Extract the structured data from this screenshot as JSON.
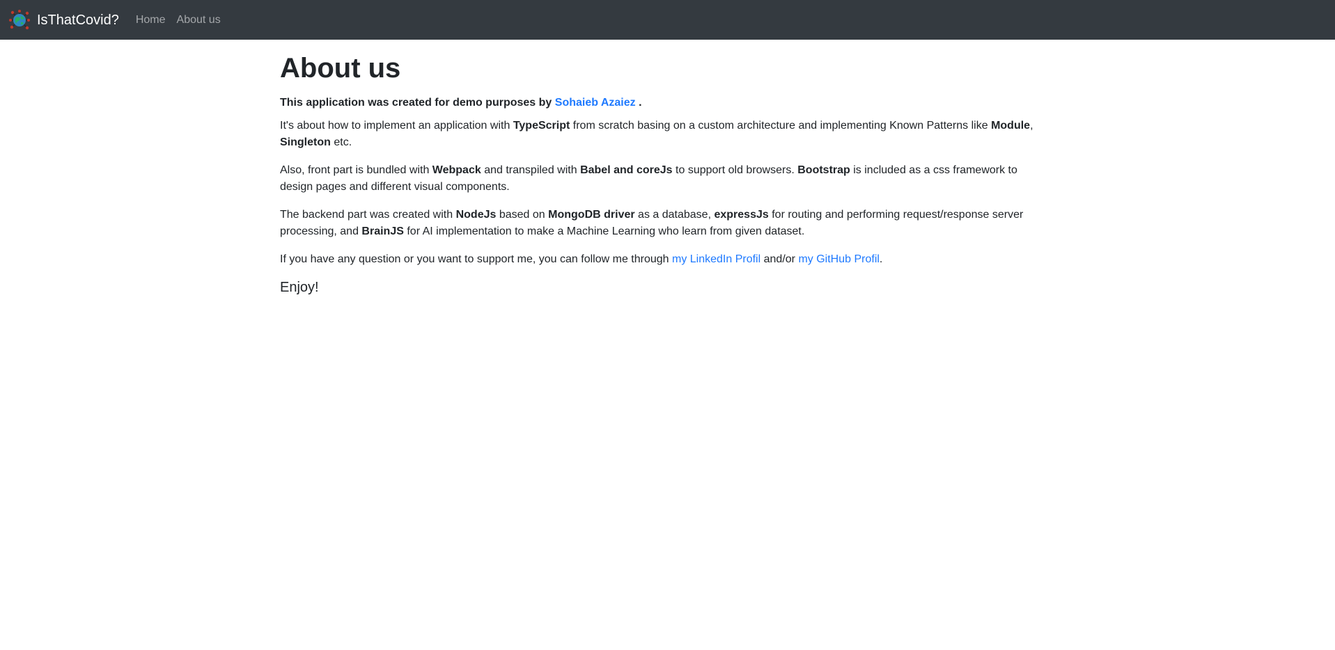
{
  "navbar": {
    "brand_name": "IsThatCovid?",
    "logo_icon": "globe-virus-icon",
    "links": [
      "Home",
      "About us"
    ]
  },
  "main": {
    "title": "About us",
    "intro": {
      "text": "This application was created for demo purposes by",
      "author": "Sohaieb Azaiez",
      "end": "."
    },
    "p1": {
      "a": "It's about how to implement an application with",
      "b1": "TypeScript",
      "c": "from scratch basing on a custom architecture and implementing Known Patterns like",
      "b2": "Module",
      "comma": ",",
      "b3": "Singleton",
      "d": "etc."
    },
    "p2": {
      "a": "Also, front part is bundled with",
      "b1": "Webpack",
      "c": "and transpiled with",
      "b2": "Babel and coreJs",
      "d": "to support old browsers.",
      "b3": "Bootstrap",
      "e": "is included as a css framework to design pages and different visual components."
    },
    "p3": {
      "a": "The backend part was created with",
      "b1": "NodeJs",
      "c": "based on",
      "b2": "MongoDB driver",
      "d": "as a database,",
      "b3": "expressJs",
      "e": "for routing and performing request/response server processing, and",
      "b4": "BrainJS",
      "f": "for AI implementation to make a Machine Learning who learn from given dataset."
    },
    "p4": {
      "a": "If you have any question or you want to support me, you can follow me through",
      "linkedin": "my LinkedIn Profil",
      "and": "and/or",
      "github": "my GitHub Profil",
      "end": "."
    },
    "enjoy": "Enjoy!"
  },
  "colors": {
    "navbar_bg": "#343a40",
    "link": "#1f7aff",
    "text": "#212529"
  }
}
